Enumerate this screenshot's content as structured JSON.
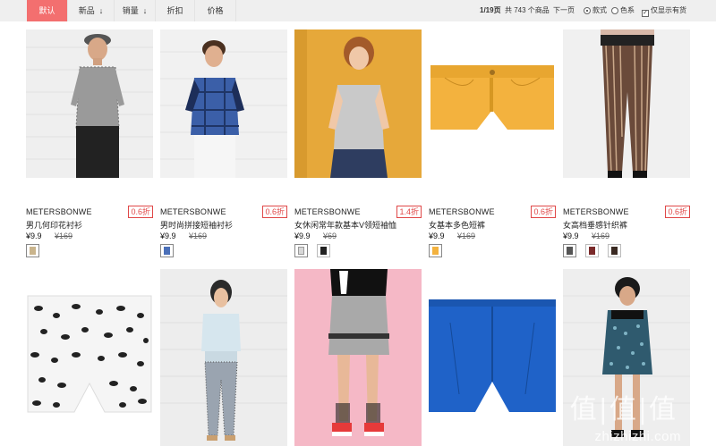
{
  "toolbar": {
    "sorts": [
      {
        "label": "默认"
      },
      {
        "label": "新品",
        "arrow": "↓"
      },
      {
        "label": "销量",
        "arrow": "↓"
      },
      {
        "label": "折扣"
      },
      {
        "label": "价格"
      }
    ],
    "pager": {
      "page": "1/19页",
      "total": "共 743 个商品",
      "next": "下一页"
    },
    "view": {
      "style_label": "款式",
      "color_label": "色系",
      "instock_label": "仅显示有货",
      "instock_check": "✓"
    }
  },
  "products": [
    {
      "brand": "METERSBONWE",
      "discount": "0.6折",
      "name": "男几何印花衬衫",
      "price": "¥9.9",
      "orig": "¥169"
    },
    {
      "brand": "METERSBONWE",
      "discount": "0.6折",
      "name": "男时尚拼接短袖衬衫",
      "price": "¥9.9",
      "orig": "¥169"
    },
    {
      "brand": "METERSBONWE",
      "discount": "1.4折",
      "name": "女休闲常年款基本V领短袖恤",
      "price": "¥9.9",
      "orig": "¥69"
    },
    {
      "brand": "METERSBONWE",
      "discount": "0.6折",
      "name": "女基本多色短裤",
      "price": "¥9.9",
      "orig": "¥169"
    },
    {
      "brand": "METERSBONWE",
      "discount": "0.6折",
      "name": "女高档垂感针织裤",
      "price": "¥9.9",
      "orig": "¥169"
    }
  ],
  "watermark": {
    "logo": "值|值|值",
    "site": "zhizhizhi.com"
  }
}
